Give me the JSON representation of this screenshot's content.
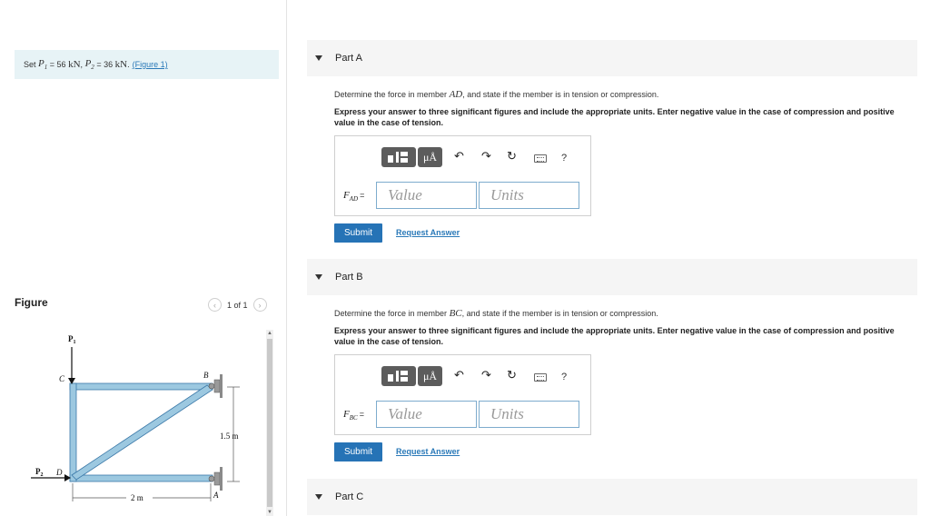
{
  "problem": {
    "prefix": "Set",
    "p1_label": "P",
    "p1_sub": "1",
    "p1_value": "= 56",
    "unit": "kN",
    "sep": ",",
    "p2_label": "P",
    "p2_sub": "2",
    "p2_value": "= 36",
    "end": ".",
    "figure_link": "(Figure 1)"
  },
  "figure": {
    "title": "Figure",
    "pager_text": "1 of 1",
    "prev_icon": "chevron-left-icon",
    "next_icon": "chevron-right-icon",
    "labels": {
      "p1": "P",
      "p1_sub": "1",
      "p2": "P",
      "p2_sub": "2",
      "c": "C",
      "d": "D",
      "b": "B",
      "a": "A",
      "height": "1.5 m",
      "width": "2 m"
    },
    "colors": {
      "member": "#9cc8e0",
      "member_edge": "#3a78a8",
      "support": "#9a9a9a"
    }
  },
  "parts": [
    {
      "label": "Part A",
      "question_prefix": "Determine the force in member",
      "member": "AD",
      "question_suffix": ", and state if the member is in tension or compression.",
      "instructions": "Express your answer to three significant figures and include the appropriate units. Enter negative value in the case of compression and positive value in the case of tension.",
      "var_name": "F",
      "var_sub": "AD",
      "eq": "=",
      "value_placeholder": "Value",
      "units_placeholder": "Units",
      "submit": "Submit",
      "request": "Request Answer"
    },
    {
      "label": "Part B",
      "question_prefix": "Determine the force in member",
      "member": "BC",
      "question_suffix": ", and state if the member is in tension or compression.",
      "instructions": "Express your answer to three significant figures and include the appropriate units. Enter negative value in the case of compression and positive value in the case of tension.",
      "var_name": "F",
      "var_sub": "BC",
      "eq": "=",
      "value_placeholder": "Value",
      "units_placeholder": "Units",
      "submit": "Submit",
      "request": "Request Answer"
    },
    {
      "label": "Part C"
    }
  ],
  "toolbar": {
    "mu_label": "μÅ",
    "undo_icon": "undo-icon",
    "redo_icon": "redo-icon",
    "reset_icon": "reset-icon",
    "keyboard_icon": "keyboard-icon",
    "help": "?"
  }
}
